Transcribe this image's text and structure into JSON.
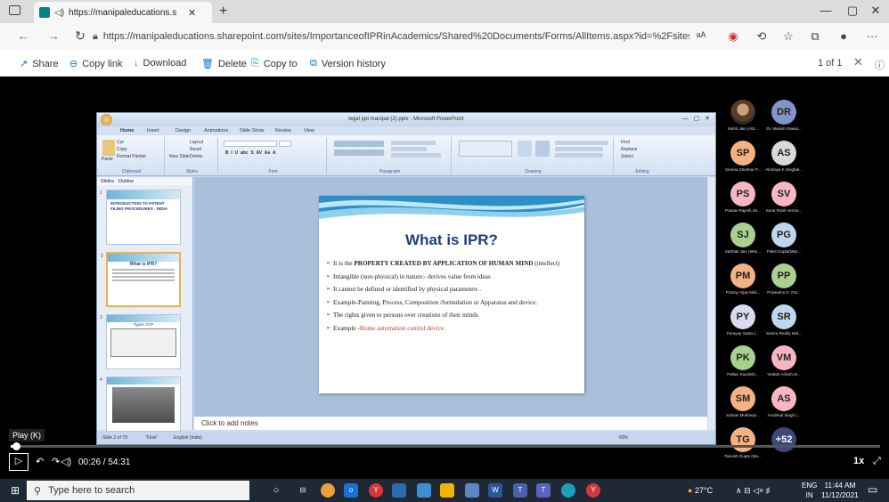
{
  "browser": {
    "tab_title": "https://manipaleducations.s",
    "new_tab": "+",
    "url": "https://manipaleducations.sharepoint.com/sites/ImportanceofIPRinAcademics/Shared%20Documents/Forms/AllItems.aspx?id=%2Fsites...",
    "window_controls": [
      "—",
      "▢",
      "✕"
    ]
  },
  "commandbar": {
    "share": "Share",
    "copy_link": "Copy link",
    "download": "Download",
    "delete": "Delete",
    "copy_to": "Copy to",
    "version_history": "Version history",
    "pager": "1 of 1"
  },
  "ppt": {
    "window_title": "legal ppt manipal (2).pptx - Microsoft PowerPoint",
    "ribbon_tabs": [
      "Home",
      "Insert",
      "Design",
      "Animations",
      "Slide Show",
      "Review",
      "View"
    ],
    "ribbon_groups": [
      "Clipboard",
      "Slides",
      "Font",
      "Paragraph",
      "Drawing",
      "Editing"
    ],
    "clipboard_items": [
      "Cut",
      "Copy",
      "Paste",
      "Format Painter"
    ],
    "slides_items": [
      "Layout",
      "Reset",
      "New Slide",
      "Delete"
    ],
    "editing_items": [
      "Find",
      "Replace",
      "Select"
    ],
    "panel_tabs": [
      "Slides",
      "Outline"
    ],
    "thumb1_title": "INTRODUCTION TO PATENT FILING PROCEDURES - INDIA",
    "thumb2_title": "What is IPR?",
    "thumb3_title": "Types of IP",
    "notes_placeholder": "Click to add notes",
    "status_slide": "Slide 2 of 79",
    "status_theme": "\"Flow\"",
    "status_lang": "English (India)",
    "zoom": "60%"
  },
  "slide": {
    "title": "What is IPR?",
    "bullets": [
      {
        "pre": "It is the ",
        "bold": "PROPERTY CREATED BY APPLICATION OF HUMAN MIND",
        "post": " (intellect)"
      },
      {
        "pre": "Intangible (non-physical) in nature:- derives value from ideas",
        "bold": "",
        "post": ""
      },
      {
        "pre": "It cannot be defined or identified by physical parameters .",
        "bold": "",
        "post": ""
      },
      {
        "pre": "Example-Painting, Process, Composition /formulation or Apparatus and device.",
        "bold": "",
        "post": ""
      },
      {
        "pre": "The rights given to persons over creations of their minds",
        "bold": "",
        "post": ""
      }
    ],
    "example_label": "Example -",
    "example_red": "Home automation control device."
  },
  "participants": [
    {
      "initials": "",
      "name": "Mohit Jain (Attr...",
      "color": "#8a6a4a",
      "photo": true
    },
    {
      "initials": "DR",
      "name": "Dr. Manish Rawat...",
      "color": "#7f95c9"
    },
    {
      "initials": "SP",
      "name": "Serena Shekhar P...",
      "color": "#f4b183"
    },
    {
      "initials": "AS",
      "name": "Akshaya K Singhal...",
      "color": "#d9d9d9"
    },
    {
      "initials": "PS",
      "name": "Pranav Rajesh Sh...",
      "color": "#f7b6c2"
    },
    {
      "initials": "SV",
      "name": "Surat Rohit Verma...",
      "color": "#f7b6c2"
    },
    {
      "initials": "SJ",
      "name": "Sarthak Jain (Man...",
      "color": "#a9d18e"
    },
    {
      "initials": "PG",
      "name": "Pulkit Gupta(Man...",
      "color": "#bdd7ee"
    },
    {
      "initials": "PM",
      "name": "Pranay Vijay Mali...",
      "color": "#f4b183"
    },
    {
      "initials": "PP",
      "name": "Priyanshu D. Pat...",
      "color": "#a9d18e"
    },
    {
      "initials": "PY",
      "name": "Purayay Yadav (...",
      "color": "#d9d9f0"
    },
    {
      "initials": "SR",
      "name": "Samra Reddy Mid...",
      "color": "#bdd7ee"
    },
    {
      "initials": "PK",
      "name": "Pallavi Kaushik(...",
      "color": "#a9d18e"
    },
    {
      "initials": "VM",
      "name": "Vedant Ashish M...",
      "color": "#f7b6c2"
    },
    {
      "initials": "SM",
      "name": "Soham Mukherje...",
      "color": "#f4b183"
    },
    {
      "initials": "AS",
      "name": "Anubhuti Singh (...",
      "color": "#f7b6c2"
    },
    {
      "initials": "TG",
      "name": "Tanvish Gupta (Ma...",
      "color": "#f4b183"
    },
    {
      "initials": "+52",
      "name": "",
      "color": "#3b4a7a"
    }
  ],
  "video": {
    "play_tooltip": "Play (K)",
    "time": "00:26 / 54:31",
    "speed": "1x",
    "progress": 0.008
  },
  "taskbar": {
    "search_placeholder": "Type here to search",
    "weather": "27°C",
    "lang_top": "ENG",
    "lang_bottom": "IN",
    "time": "11:44 AM",
    "date": "11/12/2021"
  }
}
